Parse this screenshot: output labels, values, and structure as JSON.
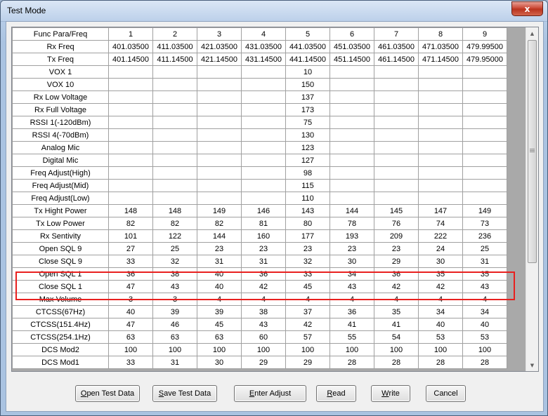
{
  "window": {
    "title": "Test Mode",
    "close_glyph": "x"
  },
  "grid": {
    "header": [
      "Func Para/Freq",
      "1",
      "2",
      "3",
      "4",
      "5",
      "6",
      "7",
      "8",
      "9"
    ],
    "rows": [
      [
        "Rx Freq",
        "401.03500",
        "411.03500",
        "421.03500",
        "431.03500",
        "441.03500",
        "451.03500",
        "461.03500",
        "471.03500",
        "479.99500"
      ],
      [
        "Tx Freq",
        "401.14500",
        "411.14500",
        "421.14500",
        "431.14500",
        "441.14500",
        "451.14500",
        "461.14500",
        "471.14500",
        "479.95000"
      ],
      [
        "VOX 1",
        "",
        "",
        "",
        "",
        "10",
        "",
        "",
        "",
        ""
      ],
      [
        "VOX 10",
        "",
        "",
        "",
        "",
        "150",
        "",
        "",
        "",
        ""
      ],
      [
        "Rx Low Voltage",
        "",
        "",
        "",
        "",
        "137",
        "",
        "",
        "",
        ""
      ],
      [
        "Rx Full Voltage",
        "",
        "",
        "",
        "",
        "173",
        "",
        "",
        "",
        ""
      ],
      [
        "RSSI 1(-120dBm)",
        "",
        "",
        "",
        "",
        "75",
        "",
        "",
        "",
        ""
      ],
      [
        "RSSI 4(-70dBm)",
        "",
        "",
        "",
        "",
        "130",
        "",
        "",
        "",
        ""
      ],
      [
        "Analog Mic",
        "",
        "",
        "",
        "",
        "123",
        "",
        "",
        "",
        ""
      ],
      [
        "Digital Mic",
        "",
        "",
        "",
        "",
        "127",
        "",
        "",
        "",
        ""
      ],
      [
        "Freq Adjust(High)",
        "",
        "",
        "",
        "",
        "98",
        "",
        "",
        "",
        ""
      ],
      [
        "Freq Adjust(Mid)",
        "",
        "",
        "",
        "",
        "115",
        "",
        "",
        "",
        ""
      ],
      [
        "Freq Adjust(Low)",
        "",
        "",
        "",
        "",
        "110",
        "",
        "",
        "",
        ""
      ],
      [
        "Tx Hight Power",
        "148",
        "148",
        "149",
        "146",
        "143",
        "144",
        "145",
        "147",
        "149"
      ],
      [
        "Tx Low Power",
        "82",
        "82",
        "82",
        "81",
        "80",
        "78",
        "76",
        "74",
        "73"
      ],
      [
        "Rx Sentivity",
        "101",
        "122",
        "144",
        "160",
        "177",
        "193",
        "209",
        "222",
        "236"
      ],
      [
        "Open SQL 9",
        "27",
        "25",
        "23",
        "23",
        "23",
        "23",
        "23",
        "24",
        "25"
      ],
      [
        "Close SQL 9",
        "33",
        "32",
        "31",
        "31",
        "32",
        "30",
        "29",
        "30",
        "31"
      ],
      [
        "Open SQL 1",
        "36",
        "38",
        "40",
        "36",
        "33",
        "34",
        "36",
        "35",
        "35"
      ],
      [
        "Close SQL 1",
        "47",
        "43",
        "40",
        "42",
        "45",
        "43",
        "42",
        "42",
        "43"
      ],
      [
        "Max Volume",
        "3",
        "3",
        "4",
        "4",
        "4",
        "4",
        "4",
        "4",
        "4"
      ],
      [
        "CTCSS(67Hz)",
        "40",
        "39",
        "39",
        "38",
        "37",
        "36",
        "35",
        "34",
        "34"
      ],
      [
        "CTCSS(151.4Hz)",
        "47",
        "46",
        "45",
        "43",
        "42",
        "41",
        "41",
        "40",
        "40"
      ],
      [
        "CTCSS(254.1Hz)",
        "63",
        "63",
        "63",
        "60",
        "57",
        "55",
        "54",
        "53",
        "53"
      ],
      [
        "DCS Mod2",
        "100",
        "100",
        "100",
        "100",
        "100",
        "100",
        "100",
        "100",
        "100"
      ],
      [
        "DCS Mod1",
        "33",
        "31",
        "30",
        "29",
        "29",
        "28",
        "28",
        "28",
        "28"
      ]
    ]
  },
  "scrollbar": {
    "up_glyph": "▲",
    "down_glyph": "▼"
  },
  "buttons": [
    {
      "mnemonic": "O",
      "rest": "pen Test Data"
    },
    {
      "mnemonic": "S",
      "rest": "ave Test Data"
    },
    {
      "mnemonic": "E",
      "rest": "nter Adjust"
    },
    {
      "mnemonic": "R",
      "rest": "ead"
    },
    {
      "mnemonic": "W",
      "rest": "rite"
    },
    {
      "mnemonic": "",
      "rest": "Cancel"
    }
  ],
  "colors": {
    "highlight_border": "#e8201f",
    "close_button": "#c7402c",
    "grid_background": "#a9a9a9"
  }
}
